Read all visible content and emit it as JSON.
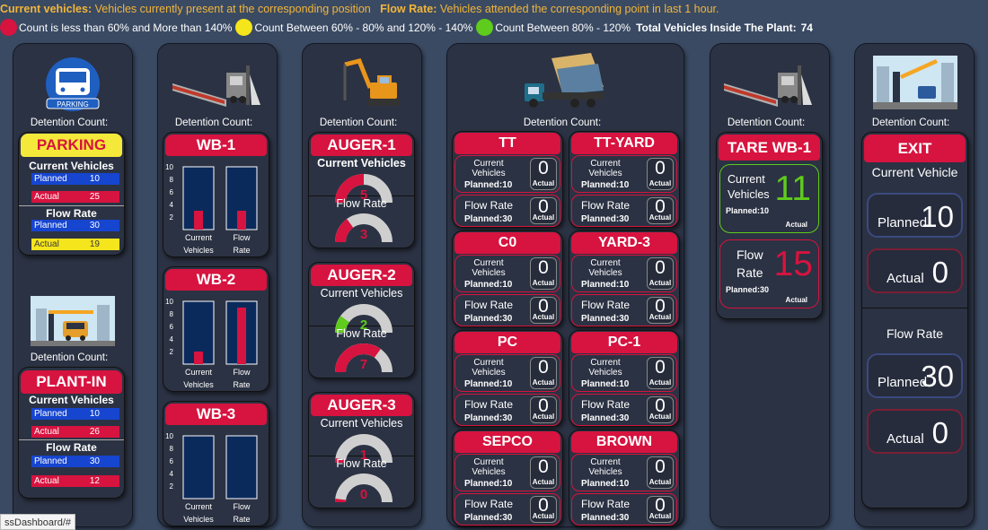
{
  "header": {
    "current_label": "Current vehicles:",
    "current_text": "Vehicles currently present at the corresponding position",
    "flow_label": "Flow Rate:",
    "flow_text": "Vehicles attended the corresponding point in last 1 hour."
  },
  "legend": {
    "red": "Count is less than 60% and More than 140%",
    "yellow": "Count Between 60% - 80% and 120% - 140%",
    "green": "Count Between 80% - 120%",
    "total_label": "Total Vehicles Inside The Plant:",
    "total_value": "74",
    "colors": {
      "red": "#d7133f",
      "yellow": "#f5e51c",
      "green": "#5fcb1d"
    }
  },
  "detention_label": "Detention Count:",
  "parking": {
    "icon": "parking-bus-icon",
    "icon_text": "PARKING",
    "title": "PARKING",
    "cv_title": "Current Vehicles",
    "fr_title": "Flow Rate",
    "cv_planned_label": "Planned",
    "cv_planned": "10",
    "cv_actual_label": "Actual",
    "cv_actual": "25",
    "fr_planned_label": "Planned",
    "fr_planned": "30",
    "fr_actual_label": "Actual",
    "fr_actual": "19"
  },
  "plantin": {
    "icon": "plant-gate-icon",
    "title": "PLANT-IN",
    "cv_title": "Current Vehicles",
    "fr_title": "Flow Rate",
    "cv_planned_label": "Planned",
    "cv_planned": "10",
    "cv_actual_label": "Actual",
    "cv_actual": "26",
    "fr_planned_label": "Planned",
    "fr_planned": "30",
    "fr_actual_label": "Actual",
    "fr_actual": "12"
  },
  "wb": [
    {
      "title": "WB-1",
      "chart": {
        "type": "bar",
        "categories": [
          "Current Vehicles",
          "Flow Rate"
        ],
        "cat1a": "Current",
        "cat1b": "Vehicles",
        "cat2a": "Flow",
        "cat2b": "Rate",
        "ylim": [
          0,
          10
        ],
        "yticks": [
          "10",
          "8",
          "6",
          "4",
          "2"
        ],
        "full": [
          10,
          10
        ],
        "values": [
          3,
          3
        ]
      }
    },
    {
      "title": "WB-2",
      "chart": {
        "type": "bar",
        "categories": [
          "Current Vehicles",
          "Flow Rate"
        ],
        "cat1a": "Current",
        "cat1b": "Vehicles",
        "cat2a": "Flow",
        "cat2b": "Rate",
        "ylim": [
          0,
          10
        ],
        "yticks": [
          "10",
          "8",
          "6",
          "4",
          "2"
        ],
        "full": [
          10,
          10
        ],
        "values": [
          2,
          9
        ]
      }
    },
    {
      "title": "WB-3",
      "chart": {
        "type": "bar",
        "categories": [
          "Current Vehicles",
          "Flow Rate"
        ],
        "cat1a": "Current",
        "cat1b": "Vehicles",
        "cat2a": "Flow",
        "cat2b": "Rate",
        "ylim": [
          0,
          10
        ],
        "yticks": [
          "10",
          "8",
          "6",
          "4",
          "2"
        ],
        "full": [
          10,
          10
        ],
        "values": [
          0,
          0
        ]
      }
    }
  ],
  "augers": [
    {
      "title": "AUGER-1",
      "cv_title": "Current Vehicles",
      "fr_title": "Flow Rate",
      "cv_value": "5",
      "fr_value": "3",
      "cv_frac": 0.5,
      "fr_frac": 0.3,
      "cv_color": "#d7133f",
      "fr_color": "#d7133f"
    },
    {
      "title": "AUGER-2",
      "cv_title": "Current Vehicles",
      "fr_title": "Flow Rate",
      "cv_value": "2",
      "fr_value": "7",
      "cv_frac": 0.2,
      "fr_frac": 0.7,
      "cv_color": "#5fcb1d",
      "fr_color": "#d7133f"
    },
    {
      "title": "AUGER-3",
      "cv_title": "Current Vehicles",
      "fr_title": "Flow Rate",
      "cv_value": "1",
      "fr_value": "0",
      "cv_frac": 0.05,
      "fr_frac": 0,
      "cv_color": "#d7133f",
      "fr_color": "#d7133f"
    }
  ],
  "grid_cards": [
    {
      "title": "TT",
      "cv_l1": "Current",
      "cv_l2": "Vehicles",
      "cv_planned": "Planned:10",
      "cv_value": "0",
      "fr_label": "Flow Rate",
      "fr_planned": "Planned:30",
      "fr_value": "0",
      "actual": "Actual"
    },
    {
      "title": "TT-YARD",
      "cv_l1": "Current",
      "cv_l2": "Vehicles",
      "cv_planned": "Planned:10",
      "cv_value": "0",
      "fr_label": "Flow Rate",
      "fr_planned": "Planned:30",
      "fr_value": "0",
      "actual": "Actual"
    },
    {
      "title": "C0",
      "cv_l1": "Current",
      "cv_l2": "Vehicles",
      "cv_planned": "Planned:10",
      "cv_value": "0",
      "fr_label": "Flow Rate",
      "fr_planned": "Planned:30",
      "fr_value": "0",
      "actual": "Actual"
    },
    {
      "title": "YARD-3",
      "cv_l1": "Current",
      "cv_l2": "Vehicles",
      "cv_planned": "Planned:10",
      "cv_value": "0",
      "fr_label": "Flow Rate",
      "fr_planned": "Planned:30",
      "fr_value": "0",
      "actual": "Actual"
    },
    {
      "title": "PC",
      "cv_l1": "Current",
      "cv_l2": "Vehicles",
      "cv_planned": "Planned:10",
      "cv_value": "0",
      "fr_label": "Flow Rate",
      "fr_planned": "Planned:30",
      "fr_value": "0",
      "actual": "Actual"
    },
    {
      "title": "PC-1",
      "cv_l1": "Current",
      "cv_l2": "Vehicles",
      "cv_planned": "Planned:10",
      "cv_value": "0",
      "fr_label": "Flow Rate",
      "fr_planned": "Planned:30",
      "fr_value": "0",
      "actual": "Actual"
    },
    {
      "title": "SEPCO",
      "cv_l1": "Current",
      "cv_l2": "Vehicles",
      "cv_planned": "Planned:10",
      "cv_value": "0",
      "fr_label": "Flow Rate",
      "fr_planned": "Planned:30",
      "fr_value": "0",
      "actual": "Actual"
    },
    {
      "title": "BROWN",
      "cv_l1": "Current",
      "cv_l2": "Vehicles",
      "cv_planned": "Planned:10",
      "cv_value": "0",
      "fr_label": "Flow Rate",
      "fr_planned": "Planned:30",
      "fr_value": "0",
      "actual": "Actual"
    }
  ],
  "tare": {
    "title": "TARE WB-1",
    "cv_l1": "Current",
    "cv_l2": "Vehicles",
    "cv_planned": "Planned:10",
    "cv_value": "11",
    "cv_color": "#5fcb1d",
    "fr_l1": "Flow",
    "fr_l2": "Rate",
    "fr_planned": "Planned:30",
    "fr_value": "15",
    "fr_color": "#d7133f",
    "actual": "Actual"
  },
  "exit": {
    "title": "EXIT",
    "cv_title": "Current Vehicle",
    "cv_planned_label": "Planned",
    "cv_planned": "10",
    "cv_actual_label": "Actual",
    "cv_actual": "0",
    "fr_title": "Flow Rate",
    "fr_planned_label": "Planned",
    "fr_planned": "30",
    "fr_actual_label": "Actual",
    "fr_actual": "0"
  },
  "statusbar": {
    "url": "ssDashboard/#"
  }
}
